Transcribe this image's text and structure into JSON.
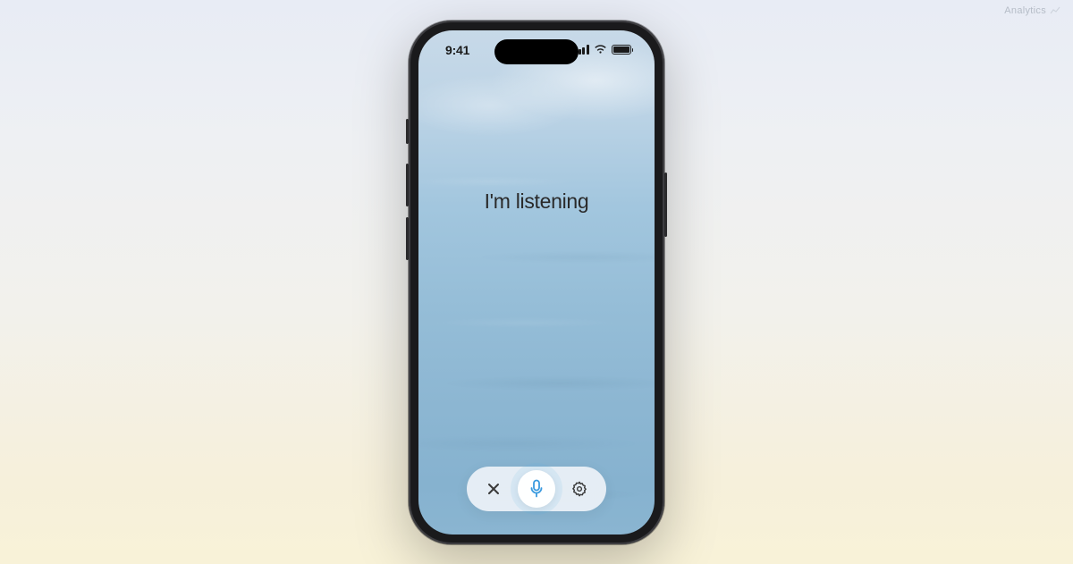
{
  "analytics_label": "Analytics",
  "status_bar": {
    "time": "9:41"
  },
  "main": {
    "listening_text": "I'm listening"
  },
  "controls": {
    "close_label": "close",
    "mic_label": "microphone",
    "settings_label": "settings"
  },
  "colors": {
    "accent": "#3a9adf",
    "water_base": "#95bdd7",
    "frame": "#1a1a1c"
  }
}
